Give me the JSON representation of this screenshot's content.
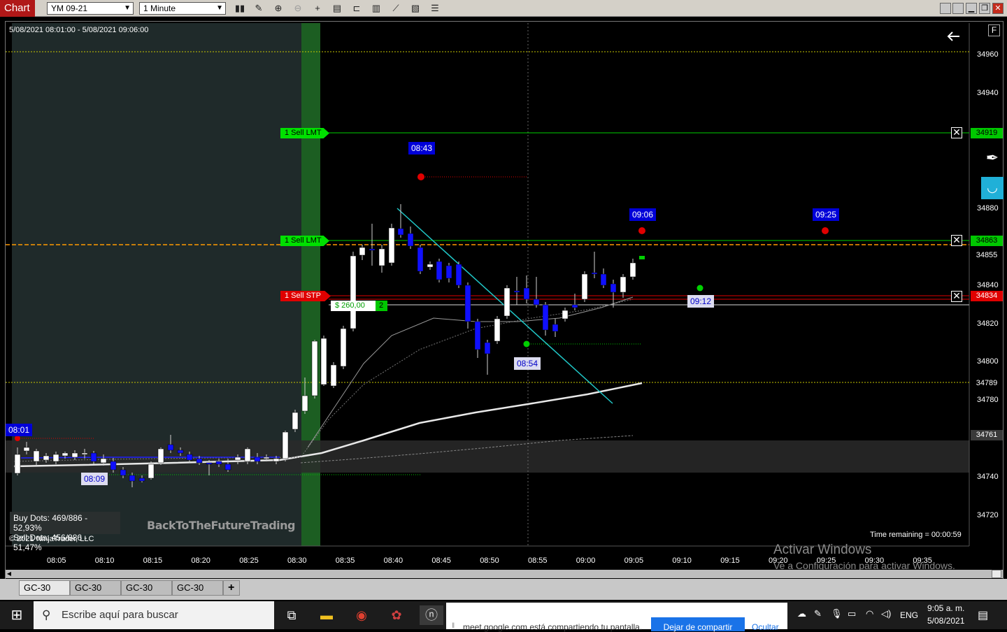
{
  "toolbar": {
    "chart_label": "Chart",
    "instrument": "YM 09-21",
    "interval": "1 Minute"
  },
  "chart": {
    "date_range": "5/08/2021 08:01:00 - 5/08/2021 09:06:00",
    "copyright": "© 2021 NinjaTrader, LLC",
    "buy_dots": "Buy Dots: 469/886 - 52,93%",
    "sell_dots": "Sell Dots: 456/886 - 51,47%",
    "watermark": "BackToTheFutureTrading",
    "time_remaining": "Time remaining = 00:00:59",
    "activate_title": "Activar Windows",
    "activate_sub": "Ve a Configuración para activar Windows.",
    "price_ticks": [
      "34960",
      "34940",
      "34880",
      "34840",
      "34820",
      "34800",
      "34780",
      "34740",
      "34720"
    ],
    "price_flags": [
      {
        "label": "34919",
        "bg": "#00c800",
        "fg": "#000000"
      },
      {
        "label": "34863",
        "bg": "#00c800",
        "fg": "#000000"
      },
      {
        "label": "34855",
        "bg": "#000000",
        "fg": "#ffffff"
      },
      {
        "label": "34834",
        "bg": "#e00000",
        "fg": "#ffffff"
      },
      {
        "label": "34789",
        "bg": "#000000",
        "fg": "#ffffff"
      },
      {
        "label": "34761",
        "bg": "#3a3a3a",
        "fg": "#ffffff"
      }
    ],
    "time_ticks": [
      "08:05",
      "08:10",
      "08:15",
      "08:20",
      "08:25",
      "08:30",
      "08:35",
      "08:40",
      "08:45",
      "08:50",
      "08:55",
      "09:00",
      "09:05",
      "09:10",
      "09:15",
      "09:20",
      "09:25",
      "09:30",
      "09:35"
    ],
    "orders": {
      "sell_lmt_1": "1  Sell LMT",
      "sell_lmt_2": "1  Sell LMT",
      "sell_stp": "1  Sell STP",
      "pnl": "$ 260,00",
      "pnl_qty": "2"
    },
    "time_labels": {
      "t0843": "08:43",
      "t0906": "09:06",
      "t0925": "09:25",
      "t0801": "08:01",
      "t0809": "08:09",
      "t0854": "08:54",
      "t0912": "09:12"
    }
  },
  "tabs": [
    "GC-30",
    "GC-30",
    "GC-30",
    "GC-30"
  ],
  "add_tab": "+",
  "taskbar": {
    "search_placeholder": "Escribe aquí para buscar",
    "share_text": "meet.google.com está compartiendo tu pantalla.",
    "share_stop": "Dejar de compartir",
    "share_hide": "Ocultar",
    "lang": "ENG",
    "time": "9:05 a. m.",
    "date": "5/08/2021"
  },
  "colors": {
    "bull": "#ffffff",
    "bear": "#1010ff",
    "sell_lmt": "#00e000",
    "sell_stp": "#e00000"
  }
}
